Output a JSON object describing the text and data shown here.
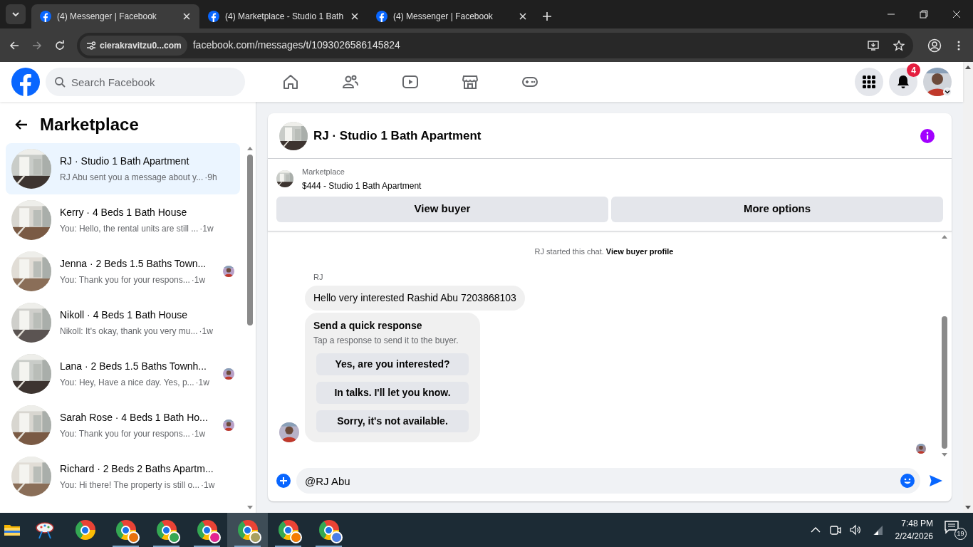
{
  "browser": {
    "tabs": [
      {
        "title": "(4) Messenger | Facebook",
        "selected": true
      },
      {
        "title": "(4) Marketplace - Studio 1 Bath",
        "selected": false
      },
      {
        "title": "(4) Messenger | Facebook",
        "selected": false
      }
    ],
    "site_chip": "cierakravitzu0...com",
    "url": "facebook.com/messages/t/1093026586145824"
  },
  "facebook_header": {
    "search_placeholder": "Search Facebook",
    "notification_count": "4"
  },
  "sidebar": {
    "title": "Marketplace",
    "conversations": [
      {
        "title": "RJ · Studio 1 Bath Apartment",
        "preview": "RJ Abu sent you a message about y...",
        "time": "·9h",
        "selected": true,
        "seen_avatar": false
      },
      {
        "title": "Kerry · 4 Beds 1 Bath House",
        "preview": "You: Hello, the rental units are still ...",
        "time": "·1w",
        "selected": false,
        "seen_avatar": false
      },
      {
        "title": "Jenna · 2 Beds 1.5 Baths Town...",
        "preview": "You: Thank you for your respons...",
        "time": "·1w",
        "selected": false,
        "seen_avatar": true
      },
      {
        "title": "Nikoll · 4 Beds 1 Bath House",
        "preview": "Nikoll: It's okay, thank you very mu...",
        "time": "·1w",
        "selected": false,
        "seen_avatar": false
      },
      {
        "title": "Lana · 2 Beds 1.5 Baths Townh...",
        "preview": "You: Hey, Have a nice day. Yes, p...",
        "time": "·1w",
        "selected": false,
        "seen_avatar": true
      },
      {
        "title": "Sarah Rose · 4 Beds 1 Bath Ho...",
        "preview": "You: Thank you for your respons...",
        "time": "·1w",
        "selected": false,
        "seen_avatar": true
      },
      {
        "title": "Richard · 2 Beds 2 Baths Apartm...",
        "preview": "You: Hi there! The property is still o...",
        "time": "·1w",
        "selected": false,
        "seen_avatar": false
      }
    ]
  },
  "chat": {
    "title": "RJ · Studio 1 Bath Apartment",
    "listing_label": "Marketplace",
    "listing_title": "$444 - Studio 1 Bath Apartment",
    "buttons": [
      "View buyer",
      "More options"
    ],
    "system_text": "RJ started this chat.",
    "system_link": "View buyer profile",
    "sender": "RJ",
    "message": "Hello very interested Rashid Abu 7203868103",
    "quick_response": {
      "title": "Send a quick response",
      "subtitle": "Tap a response to send it to the buyer.",
      "options": [
        "Yes, are you interested?",
        "In talks. I'll let you know.",
        "Sorry, it's not available."
      ]
    },
    "composer_value": "@RJ Abu"
  },
  "taskbar": {
    "apps": [
      {
        "kind": "folder",
        "selected": false
      },
      {
        "kind": "paint",
        "selected": false
      },
      {
        "kind": "chrome",
        "selected": false
      },
      {
        "kind": "chrome-profile",
        "color": "#e8710a",
        "selected": false
      },
      {
        "kind": "chrome-profile",
        "color": "#34a853",
        "selected": false
      },
      {
        "kind": "chrome-profile",
        "color": "#e52592",
        "selected": false
      },
      {
        "kind": "chrome-profile",
        "color": "#a8a060",
        "selected": true
      },
      {
        "kind": "chrome-profile",
        "color": "#f57c00",
        "selected": false
      },
      {
        "kind": "chrome-profile",
        "color": "#4a7ee8",
        "selected": false
      }
    ],
    "time": "7:48 PM",
    "date": "2/24/2026",
    "notifications": "19"
  }
}
